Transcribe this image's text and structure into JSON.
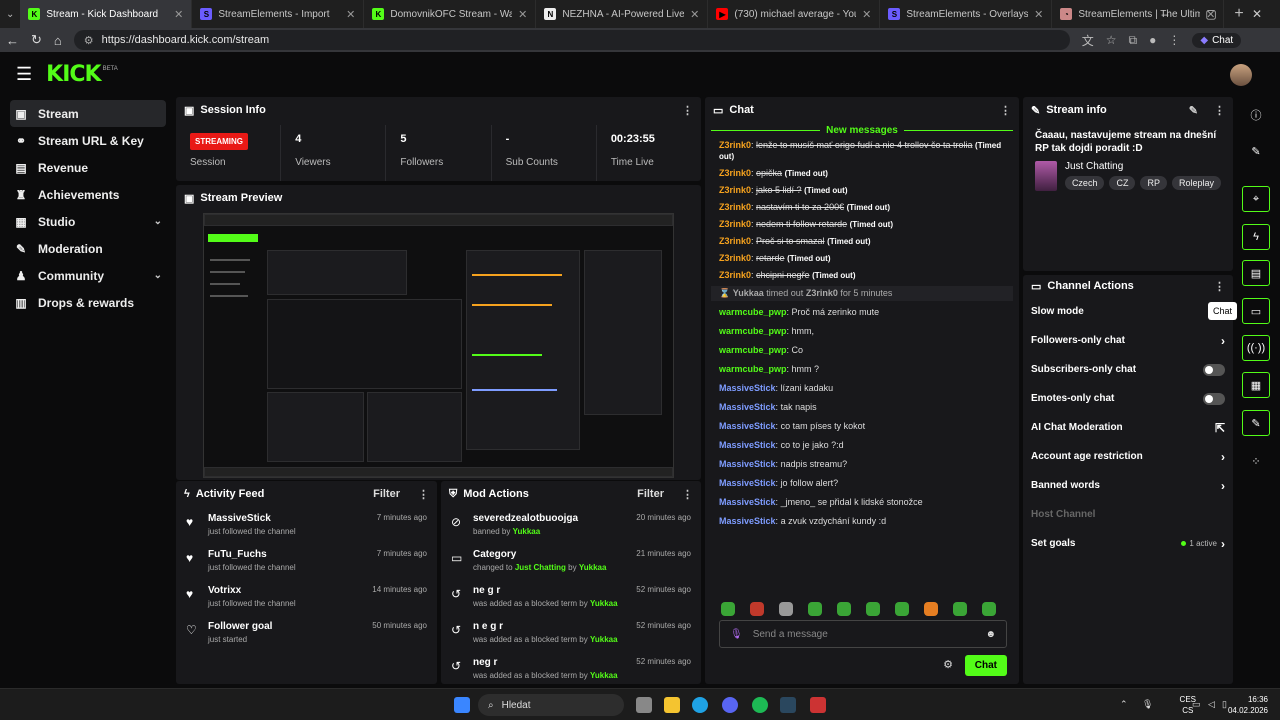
{
  "browser": {
    "tabs": [
      {
        "title": "Stream - Kick Dashboard",
        "color": "#53fc18",
        "glyph": "K",
        "active": true
      },
      {
        "title": "StreamElements - Import",
        "color": "#6b5cff",
        "glyph": "S"
      },
      {
        "title": "DomovnikOFC Stream - Watch Live",
        "color": "#53fc18",
        "glyph": "K"
      },
      {
        "title": "NEZHNA - AI-Powered Live Stream",
        "color": "#eeeeee",
        "glyph": "N"
      },
      {
        "title": "(730) michael average - YouTube",
        "color": "#ff0000",
        "glyph": "▶"
      },
      {
        "title": "StreamElements - Overlays",
        "color": "#6b5cff",
        "glyph": "S"
      },
      {
        "title": "StreamElements | The Ultimate Str...",
        "color": "#c88",
        "glyph": "◔"
      }
    ],
    "url": "https://dashboard.kick.com/stream",
    "chat_pill": "Chat"
  },
  "app": {
    "logo": "KICK",
    "logo_sup": "BETA"
  },
  "sidebar": [
    {
      "label": "Stream",
      "icon": "broadcast-icon",
      "glyph": "▣",
      "active": true
    },
    {
      "label": "Stream URL & Key",
      "icon": "link-icon",
      "glyph": "⚭"
    },
    {
      "label": "Revenue",
      "icon": "revenue-icon",
      "glyph": "▤"
    },
    {
      "label": "Achievements",
      "icon": "trophy-icon",
      "glyph": "♜"
    },
    {
      "label": "Studio",
      "icon": "studio-icon",
      "glyph": "▦",
      "chevron": "⌄"
    },
    {
      "label": "Moderation",
      "icon": "wrench-icon",
      "glyph": "✎"
    },
    {
      "label": "Community",
      "icon": "community-icon",
      "glyph": "♟",
      "chevron": "⌄"
    },
    {
      "label": "Drops & rewards",
      "icon": "gift-icon",
      "glyph": "▥"
    }
  ],
  "session": {
    "title": "Session Info",
    "badge": "STREAMING",
    "stats": [
      {
        "value": "",
        "label": "Session"
      },
      {
        "value": "4",
        "label": "Viewers"
      },
      {
        "value": "5",
        "label": "Followers"
      },
      {
        "value": "-",
        "label": "Sub Counts"
      },
      {
        "value": "00:23:55",
        "label": "Time Live"
      }
    ]
  },
  "preview": {
    "title": "Stream Preview"
  },
  "activity": {
    "title": "Activity Feed",
    "filter": "Filter",
    "items": [
      {
        "name": "MassiveStick",
        "sub": "just followed the channel",
        "time": "7 minutes ago",
        "icon": "heart-icon",
        "glyph": "♥"
      },
      {
        "name": "FuTu_Fuchs",
        "sub": "just followed the channel",
        "time": "7 minutes ago",
        "icon": "heart-icon",
        "glyph": "♥"
      },
      {
        "name": "Votrixx",
        "sub": "just followed the channel",
        "time": "14 minutes ago",
        "icon": "heart-icon",
        "glyph": "♥"
      },
      {
        "name": "Follower goal",
        "sub": "just started",
        "time": "50 minutes ago",
        "icon": "heart-outline-icon",
        "glyph": "♡"
      }
    ]
  },
  "mod": {
    "title": "Mod Actions",
    "filter": "Filter",
    "items": [
      {
        "name": "severedzealotbuoojga",
        "pre": "banned by",
        "hl": "Yukkaa",
        "mid": "",
        "by": "",
        "time": "20 minutes ago",
        "icon": "ban-icon",
        "glyph": "⊘"
      },
      {
        "name": "Category",
        "pre": "changed to",
        "hl": "Just Chatting",
        "mid": "by",
        "by": "Yukkaa",
        "time": "21 minutes ago",
        "icon": "category-icon",
        "glyph": "▭"
      },
      {
        "name": "ne g r",
        "pre": "was added as a blocked term by",
        "hl": "Yukkaa",
        "mid": "",
        "by": "",
        "time": "52 minutes ago",
        "icon": "history-icon",
        "glyph": "↺"
      },
      {
        "name": "n e g r",
        "pre": "was added as a blocked term by",
        "hl": "Yukkaa",
        "mid": "",
        "by": "",
        "time": "52 minutes ago",
        "icon": "history-icon",
        "glyph": "↺"
      },
      {
        "name": "neg r",
        "pre": "was added as a blocked term by",
        "hl": "Yukkaa",
        "mid": "",
        "by": "",
        "time": "52 minutes ago",
        "icon": "history-icon",
        "glyph": "↺"
      }
    ]
  },
  "chat": {
    "title": "Chat",
    "new_messages": "New messages",
    "messages": [
      {
        "user": "Z3rink0",
        "color": "#f6a21e",
        "text": "lenže to musíš mať origo fudí a nie 4 trollov čo ta trolia",
        "struck": true,
        "note": "(Timed out)"
      },
      {
        "user": "Z3rink0",
        "color": "#f6a21e",
        "text": "opička",
        "struck": true,
        "note": "(Timed out)"
      },
      {
        "user": "Z3rink0",
        "color": "#f6a21e",
        "text": "jako 5 lidí ?",
        "struck": true,
        "note": "(Timed out)"
      },
      {
        "user": "Z3rink0",
        "color": "#f6a21e",
        "text": "nastavím ti to za 200€",
        "struck": true,
        "note": "(Timed out)"
      },
      {
        "user": "Z3rink0",
        "color": "#f6a21e",
        "text": "nedem ti follow retarde",
        "struck": true,
        "note": "(Timed out)"
      },
      {
        "user": "Z3rink0",
        "color": "#f6a21e",
        "text": "Proč si to smazal",
        "struck": true,
        "note": "(Timed out)"
      },
      {
        "user": "Z3rink0",
        "color": "#f6a21e",
        "text": "retarde",
        "struck": true,
        "note": "(Timed out)"
      },
      {
        "user": "Z3rink0",
        "color": "#f6a21e",
        "text": "chcipni negře",
        "struck": true,
        "note": "(Timed out)"
      }
    ],
    "system": {
      "actor": "Yukkaa",
      "pre": "timed out",
      "target": "Z3rink0",
      "post": "for 5 minutes"
    },
    "messages2": [
      {
        "user": "warmcube_pwp",
        "color": "#53fc18",
        "text": "Proč má zerinko mute"
      },
      {
        "user": "warmcube_pwp",
        "color": "#53fc18",
        "text": "hmm,"
      },
      {
        "user": "warmcube_pwp",
        "color": "#53fc18",
        "text": "Co"
      },
      {
        "user": "warmcube_pwp",
        "color": "#53fc18",
        "text": "hmm ?"
      },
      {
        "user": "MassiveStick",
        "color": "#7e9cff",
        "text": "lízani kadaku"
      },
      {
        "user": "MassiveStick",
        "color": "#7e9cff",
        "text": "tak napis"
      },
      {
        "user": "MassiveStick",
        "color": "#7e9cff",
        "text": "co tam píses ty kokot"
      },
      {
        "user": "MassiveStick",
        "color": "#7e9cff",
        "text": "co to je jako ?:d"
      },
      {
        "user": "MassiveStick",
        "color": "#7e9cff",
        "text": "nadpis streamu?"
      },
      {
        "user": "MassiveStick",
        "color": "#7e9cff",
        "text": "jo follow alert?"
      },
      {
        "user": "MassiveStick",
        "color": "#7e9cff",
        "text": "_jmeno_ se přidal k lidské stonožce"
      },
      {
        "user": "MassiveStick",
        "color": "#7e9cff",
        "text": "a zvuk vzdychání kundy :d"
      }
    ],
    "placeholder": "Send a message",
    "send": "Chat"
  },
  "stream_info": {
    "title": "Stream info",
    "stream_title": "Čaaau, nastavujeme stream na dnešní RP tak dojdi poradit :D",
    "category": "Just Chatting",
    "tags": [
      "Czech",
      "CZ",
      "RP",
      "Roleplay"
    ]
  },
  "actions": {
    "title": "Channel Actions",
    "items": [
      {
        "label": "Slow mode",
        "kind": "none"
      },
      {
        "label": "Followers-only chat",
        "kind": "chevron"
      },
      {
        "label": "Subscribers-only chat",
        "kind": "toggle"
      },
      {
        "label": "Emotes-only chat",
        "kind": "toggle"
      },
      {
        "label": "AI Chat Moderation",
        "kind": "external"
      },
      {
        "label": "Account age restriction",
        "kind": "chevron"
      },
      {
        "label": "Banned words",
        "kind": "chevron"
      },
      {
        "label": "Host Channel",
        "kind": "disabled"
      },
      {
        "label": "Set goals",
        "kind": "goals",
        "extra": "1 active"
      }
    ]
  },
  "rail": {
    "tooltip": "Chat",
    "buttons": [
      {
        "name": "info-icon",
        "glyph": "ⓘ"
      },
      {
        "name": "edit-icon",
        "glyph": "✎"
      },
      {
        "name": "camera-icon",
        "glyph": "⌖",
        "hl": true
      },
      {
        "name": "lightning-icon",
        "glyph": "ϟ",
        "hl": true
      },
      {
        "name": "document-icon",
        "glyph": "▤",
        "hl": true
      },
      {
        "name": "chat-icon",
        "glyph": "▭",
        "hl": true
      },
      {
        "name": "broadcast-icon",
        "glyph": "((·))",
        "hl": true
      },
      {
        "name": "sliders-icon",
        "glyph": "▦",
        "hl": true
      },
      {
        "name": "wrench-icon",
        "glyph": "✎",
        "hl": true
      },
      {
        "name": "more-icon",
        "glyph": "⁘"
      }
    ]
  },
  "taskbar": {
    "search": "Hledat",
    "lang_top": "CES",
    "lang_bottom": "CS",
    "time": "16:36",
    "date": "04.02.2026"
  }
}
